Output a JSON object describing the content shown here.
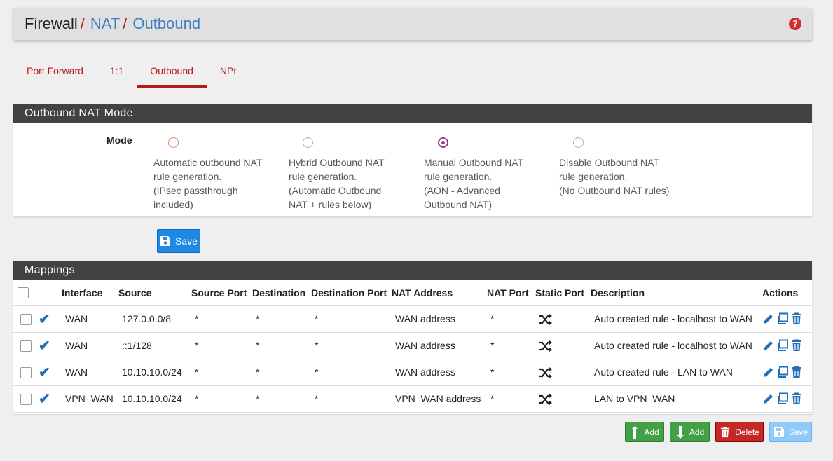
{
  "breadcrumb": {
    "level1": "Firewall",
    "level2": "NAT",
    "level3": "Outbound",
    "separator": "/"
  },
  "tabs": [
    {
      "label": "Port Forward"
    },
    {
      "label": "1:1"
    },
    {
      "label": "Outbound"
    },
    {
      "label": "NPt"
    }
  ],
  "mode_panel": {
    "title": "Outbound NAT Mode",
    "mode_label": "Mode",
    "options": [
      {
        "line1": "Automatic outbound NAT",
        "line2": "rule generation.",
        "line3": "(IPsec passthrough",
        "line4": "included)"
      },
      {
        "line1": "Hybrid Outbound NAT",
        "line2": "rule generation.",
        "line3": "(Automatic Outbound",
        "line4": "NAT + rules below)"
      },
      {
        "line1": "Manual Outbound NAT",
        "line2": "rule generation.",
        "line3": "(AON - Advanced",
        "line4": "Outbound NAT)"
      },
      {
        "line1": "Disable Outbound NAT",
        "line2": "rule generation.",
        "line3": "(No Outbound NAT rules)",
        "line4": ""
      }
    ],
    "save_label": "Save"
  },
  "mappings": {
    "title": "Mappings",
    "columns": [
      "Interface",
      "Source",
      "Source Port",
      "Destination",
      "Destination Port",
      "NAT Address",
      "NAT Port",
      "Static Port",
      "Description",
      "Actions"
    ],
    "rows": [
      {
        "interface": "WAN",
        "source": "127.0.0.0/8",
        "source_port": "*",
        "destination": "*",
        "destination_port": "*",
        "nat_address": "WAN address",
        "nat_port": "*",
        "description": "Auto created rule - localhost to WAN"
      },
      {
        "interface": "WAN",
        "source": "::1/128",
        "source_port": "*",
        "destination": "*",
        "destination_port": "*",
        "nat_address": "WAN address",
        "nat_port": "*",
        "description": "Auto created rule - localhost to WAN"
      },
      {
        "interface": "WAN",
        "source": "10.10.10.0/24",
        "source_port": "*",
        "destination": "*",
        "destination_port": "*",
        "nat_address": "WAN address",
        "nat_port": "*",
        "description": "Auto created rule - LAN to WAN"
      },
      {
        "interface": "VPN_WAN",
        "source": "10.10.10.0/24",
        "source_port": "*",
        "destination": "*",
        "destination_port": "*",
        "nat_address": "VPN_WAN address",
        "nat_port": "*",
        "description": "LAN to VPN_WAN"
      }
    ]
  },
  "bottom_buttons": {
    "add_top": "Add",
    "add_bottom": "Add",
    "delete": "Delete",
    "save": "Save"
  }
}
